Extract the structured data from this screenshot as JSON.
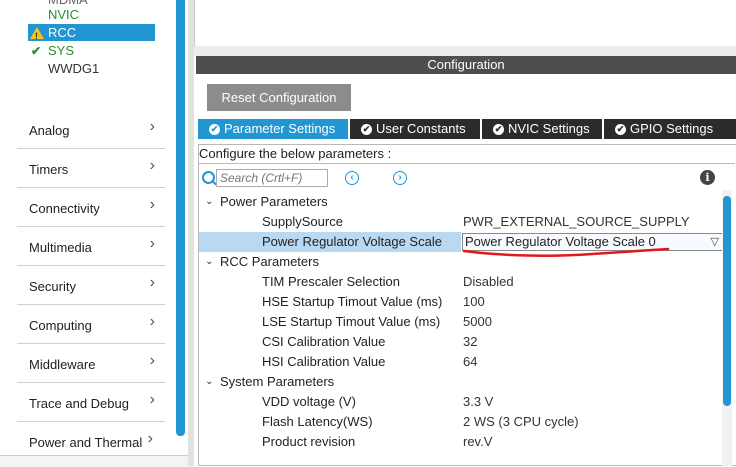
{
  "tree": {
    "partial_item": "MDMA",
    "items": [
      {
        "label": "NVIC",
        "status": "ok-plain"
      },
      {
        "label": "RCC",
        "status": "warning"
      },
      {
        "label": "SYS",
        "status": "checked"
      },
      {
        "label": "WWDG1",
        "status": "none"
      }
    ]
  },
  "categories": [
    "Analog",
    "Timers",
    "Connectivity",
    "Multimedia",
    "Security",
    "Computing",
    "Middleware",
    "Trace and Debug",
    "Power and Thermal"
  ],
  "configuration": {
    "title": "Configuration",
    "reset_label": "Reset Configuration",
    "tabs": [
      {
        "label": "Parameter Settings",
        "active": true
      },
      {
        "label": "User Constants",
        "active": false
      },
      {
        "label": "NVIC Settings",
        "active": false
      },
      {
        "label": "GPIO Settings",
        "active": false
      }
    ],
    "hint": "Configure the below parameters :",
    "search_placeholder": "Search (Crtl+F)",
    "groups": {
      "power": "Power Parameters",
      "rcc": "RCC Parameters",
      "system": "System Parameters"
    },
    "params": {
      "supply_source": {
        "name": "SupplySource",
        "value": "PWR_EXTERNAL_SOURCE_SUPPLY"
      },
      "voltage_scale": {
        "name": "Power Regulator Voltage Scale",
        "value": "Power Regulator Voltage Scale 0"
      },
      "tim_prescaler": {
        "name": "TIM Prescaler Selection",
        "value": "Disabled"
      },
      "hse_startup": {
        "name": "HSE Startup Timout Value (ms)",
        "value": "100"
      },
      "lse_startup": {
        "name": "LSE Startup Timout Value (ms)",
        "value": "5000"
      },
      "csi_cal": {
        "name": "CSI Calibration Value",
        "value": "32"
      },
      "hsi_cal": {
        "name": "HSI Calibration Value",
        "value": "64"
      },
      "vdd": {
        "name": "VDD voltage (V)",
        "value": "3.3 V"
      },
      "flash_latency": {
        "name": "Flash Latency(WS)",
        "value": "2 WS (3 CPU cycle)"
      },
      "product_rev": {
        "name": "Product revision",
        "value": "rev.V"
      }
    }
  },
  "colors": {
    "accent": "#2196d3",
    "ok": "#2a8f2a",
    "warning": "#f5c518",
    "annotation": "#e0191e"
  }
}
